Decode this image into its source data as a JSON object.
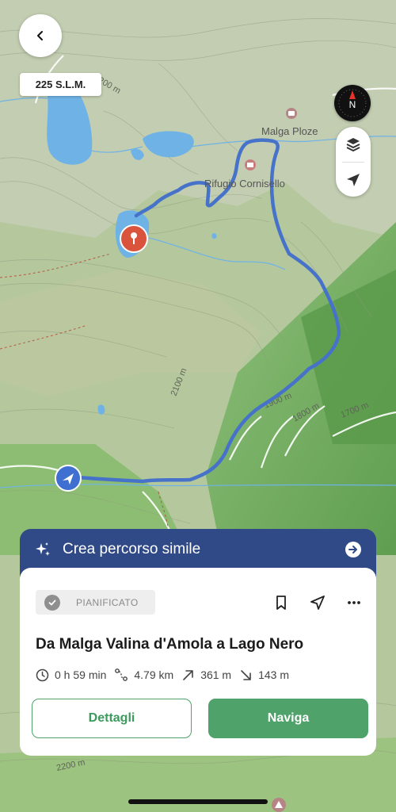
{
  "map": {
    "altitude_label": "225 S.L.M.",
    "poi_labels": [
      "Malga Ploze",
      "Rifugio Cornisello"
    ],
    "contour_labels": [
      "2200 m",
      "2100 m",
      "1900 m",
      "1800 m",
      "1700 m",
      "2200 m"
    ],
    "route_color": "#4673c9",
    "destination_color": "#d9533d",
    "user_location_color": "#3f6fd1"
  },
  "similar_route": {
    "label": "Crea percorso simile"
  },
  "route": {
    "status": "PIANIFICATO",
    "title": "Da Malga Valina d'Amola a Lago Nero",
    "duration": "0 h 59 min",
    "distance": "4.79 km",
    "ascent": "361 m",
    "descent": "143 m"
  },
  "buttons": {
    "details": "Dettagli",
    "navigate": "Naviga"
  },
  "colors": {
    "primary_green": "#4ea26a",
    "banner_blue": "#2f4a87"
  }
}
